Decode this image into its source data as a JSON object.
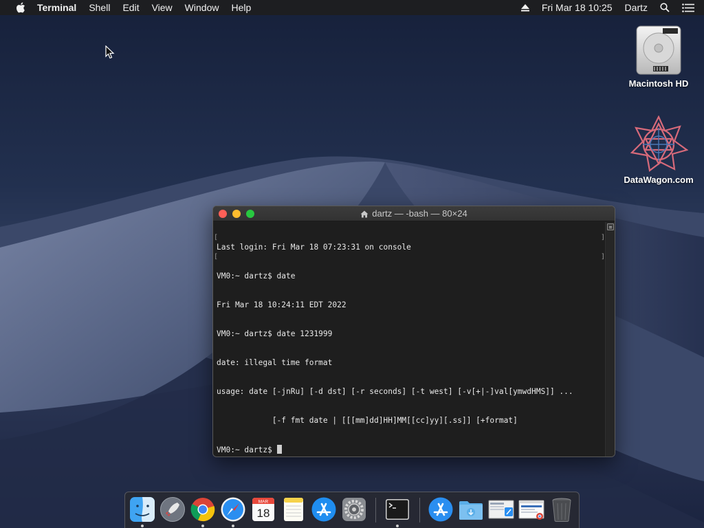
{
  "menubar": {
    "app_name": "Terminal",
    "menus": [
      "Shell",
      "Edit",
      "View",
      "Window",
      "Help"
    ],
    "datetime": "Fri Mar 18  10:25",
    "user": "Dartz"
  },
  "desktop": {
    "icons": [
      {
        "label": "Macintosh HD",
        "icon": "hard-drive-icon"
      },
      {
        "label": "DataWagon.com",
        "icon": "datawagon-logo-icon"
      }
    ]
  },
  "terminal": {
    "title": "dartz — -bash — 80×24",
    "lines": [
      "Last login: Fri Mar 18 07:23:31 on console",
      "VM0:~ dartz$ date",
      "Fri Mar 18 10:24:11 EDT 2022",
      "VM0:~ dartz$ date 1231999",
      "date: illegal time format",
      "usage: date [-jnRu] [-d dst] [-r seconds] [-t west] [-v[+|-]val[ymwdHMS]] ...",
      "            [-f fmt date | [[[mm]dd]HH]MM[[cc]yy][.ss]] [+format]"
    ],
    "prompt": "VM0:~ dartz$ "
  },
  "dock": {
    "items": [
      {
        "name": "Finder",
        "icon": "finder-icon",
        "running": true
      },
      {
        "name": "Launchpad",
        "icon": "launchpad-icon",
        "running": false
      },
      {
        "name": "Google Chrome",
        "icon": "chrome-icon",
        "running": true
      },
      {
        "name": "Safari",
        "icon": "safari-icon",
        "running": true
      },
      {
        "name": "Calendar",
        "icon": "calendar-icon",
        "running": false,
        "month": "MAR",
        "day": "18"
      },
      {
        "name": "Notes",
        "icon": "notes-icon",
        "running": false
      },
      {
        "name": "App Store",
        "icon": "app-store-icon",
        "running": false
      },
      {
        "name": "System Preferences",
        "icon": "system-preferences-icon",
        "running": false
      },
      {
        "name": "Terminal",
        "icon": "terminal-icon",
        "running": true
      },
      {
        "name": "Applications",
        "icon": "applications-folder-icon",
        "running": false
      },
      {
        "name": "Downloads",
        "icon": "downloads-folder-icon",
        "running": false
      },
      {
        "name": "Screenshot",
        "icon": "screenshot-thumbnail-icon",
        "running": false
      },
      {
        "name": "Chrome Window",
        "icon": "chrome-window-thumbnail-icon",
        "running": false
      },
      {
        "name": "Trash",
        "icon": "trash-icon",
        "running": false
      }
    ]
  },
  "colors": {
    "menubar_bg": "#1e1e20",
    "terminal_bg": "#1e1e1e",
    "close": "#fe5f57",
    "minimize": "#febc2e",
    "maximize": "#28c840"
  }
}
